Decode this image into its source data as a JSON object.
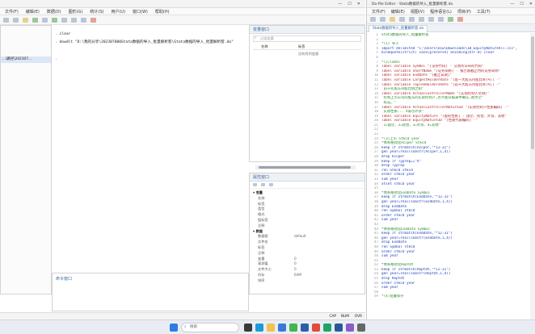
{
  "main_window": {
    "menu": [
      "文件(F)",
      "编辑(E)",
      "数据(D)",
      "图形(G)",
      "统计(S)",
      "用户(U)",
      "窗口(W)",
      "帮助(H)"
    ],
    "left_panel_path": "...\\路径\\202307...",
    "results": {
      "cmd1": ". clear",
      "cmd2": ". dowdlt \"D:\\我的分享\\202307000Stata数据的导入_批量解析客\\Stata数据的导入_批量解析客.do\"",
      "dot": "."
    },
    "variables_pane": {
      "title": "变量窗口",
      "filter_placeholder": "过滤变量",
      "col_name": "名称",
      "col_label": "标签",
      "empty_text": "没有找到变量"
    },
    "properties_pane": {
      "title": "属性窗口",
      "section_vars": "变量",
      "var_props": [
        "名称",
        "标签",
        "类型",
        "格式",
        "值标签",
        "注释"
      ],
      "section_data": "数据",
      "data_rows": [
        {
          "k": "数据框",
          "v": "default"
        },
        {
          "k": "文件名",
          "v": ""
        },
        {
          "k": "标签",
          "v": ""
        },
        {
          "k": "注释",
          "v": ""
        },
        {
          "k": "变量",
          "v": "0"
        },
        {
          "k": "观测值",
          "v": "0"
        },
        {
          "k": "文件大小",
          "v": "0"
        },
        {
          "k": "内存",
          "v": "64M"
        },
        {
          "k": "排序",
          "v": ""
        }
      ]
    },
    "command_pane": {
      "title": "命令窗口"
    },
    "status": {
      "caps": "CAP",
      "num": "NUM",
      "ovr": "OVR"
    }
  },
  "do_editor": {
    "title": "Do-file Editor - Stata数据的导入_批量解析客.do",
    "menu": [
      "文件(F)",
      "编辑(E)",
      "视图(V)",
      "程序语言(L)",
      "项目(P)",
      "工具(T)"
    ],
    "tab": "Stata数据的导入_批量解析客.do",
    "lines": [
      {
        "t": "c",
        "s": "Stata数据的导入_批量解析客"
      },
      {
        "t": "p",
        "s": ""
      },
      {
        "t": "c",
        "s": "*(1) 导入"
      },
      {
        "t": "k",
        "s": "import delimited \"C:\\Users\\kzw\\Downloads\\IB_EquityNatureAll.csv\","
      },
      {
        "t": "k",
        "s": "bindquote(strict) case(preserve) encoding(UTF-8) clear"
      },
      {
        "t": "p",
        "s": ""
      },
      {
        "t": "c",
        "s": "*(2)label"
      },
      {
        "t": "s",
        "s": "label variable Symbol \"[证券代码] - 交易所公布的代码\""
      },
      {
        "t": "s",
        "s": "label variable ShortName \"[证券简称] - 报告期截止时的证券简称\""
      },
      {
        "t": "s",
        "s": "label variable EndDate \"[截止日期]\""
      },
      {
        "t": "s",
        "s": "label variable LargestHolderRate \"[第一大股东持股比率(%)] -\""
      },
      {
        "t": "s",
        "s": "label variable TopTenHoldersRate \"[前十大股东持股比率(%)] -\""
      },
      {
        "t": "c",
        "s": "  前十名股东持股比例之和\""
      },
      {
        "t": "s",
        "s": "label variable ActualControllerName \"[实际控制人名称]\""
      },
      {
        "t": "c",
        "s": "  控制上市公司的股东的实际控制人,若不能从报表中确认,则为空\""
      },
      {
        "t": "c",
        "s": "  标志。\""
      },
      {
        "t": "s",
        "s": "label variable ActualControllerNatureID \"[实际控制人性质编码] -\""
      },
      {
        "t": "c",
        "s": "  实际性质... 4表示外资\""
      },
      {
        "t": "s",
        "s": "label variable EquityNature \"[股权性质] - 国企、民营、外资、其他\""
      },
      {
        "t": "s",
        "s": "label variable EquityNatureID \"[性质代表编码] -\""
      },
      {
        "t": "c",
        "s": "  1=国企、2=民营、3=外资、4=其他\""
      },
      {
        "t": "p",
        "s": ""
      },
      {
        "t": "p",
        "s": ""
      },
      {
        "t": "c",
        "s": "*(3)上市 Stkcd year"
      },
      {
        "t": "c",
        "s": "*体系格式化Accper Stkcd"
      },
      {
        "t": "k",
        "s": "keep if strmatch(Accper,\"*12-31\")"
      },
      {
        "t": "k",
        "s": "gen year=real(substr(Accper,1,4))"
      },
      {
        "t": "k",
        "s": "drop Accper"
      },
      {
        "t": "k",
        "s": "keep if Typrep==\"A\""
      },
      {
        "t": "k",
        "s": "drop Typrep"
      },
      {
        "t": "k",
        "s": "ren Stkcd stkcd"
      },
      {
        "t": "k",
        "s": "order stkcd year"
      },
      {
        "t": "k",
        "s": "sum year"
      },
      {
        "t": "k",
        "s": "xtset stkcd year"
      },
      {
        "t": "p",
        "s": ""
      },
      {
        "t": "c",
        "s": "*体系格式化EndDate Symbol"
      },
      {
        "t": "k",
        "s": "keep if strmatch(EndDate,\"*12-31\")"
      },
      {
        "t": "k",
        "s": "gen year=real(substr(EndDate,1,4))"
      },
      {
        "t": "k",
        "s": "drop EndDate"
      },
      {
        "t": "k",
        "s": "ren Symbol stkcd"
      },
      {
        "t": "k",
        "s": "order stkcd year"
      },
      {
        "t": "k",
        "s": "sum year"
      },
      {
        "t": "p",
        "s": ""
      },
      {
        "t": "c",
        "s": "*体系格式化Enddate Symbol"
      },
      {
        "t": "k",
        "s": "keep if strmatch(Enddate,\"*12-31\")"
      },
      {
        "t": "k",
        "s": "gen year=real(substr(Enddate,1,4))"
      },
      {
        "t": "k",
        "s": "drop Enddate"
      },
      {
        "t": "k",
        "s": "ren Symbol stkcd"
      },
      {
        "t": "k",
        "s": "order stkcd year"
      },
      {
        "t": "k",
        "s": "sum year"
      },
      {
        "t": "p",
        "s": ""
      },
      {
        "t": "c",
        "s": "*体系格式化Reptdt"
      },
      {
        "t": "k",
        "s": "keep if strmatch(Reptdt,\"*12-31\")"
      },
      {
        "t": "k",
        "s": "gen year=real(substr(Reptdt,1,4))"
      },
      {
        "t": "k",
        "s": "drop Reptdt"
      },
      {
        "t": "k",
        "s": "order stkcd year"
      },
      {
        "t": "k",
        "s": "sum year"
      },
      {
        "t": "p",
        "s": ""
      },
      {
        "t": "c",
        "s": "*(4)变量保存"
      }
    ]
  },
  "taskbar": {
    "search_placeholder": "搜索"
  },
  "colors": {
    "accent": "#2b5ea7",
    "comment": "#2a8a2a",
    "string": "#b3262b"
  }
}
